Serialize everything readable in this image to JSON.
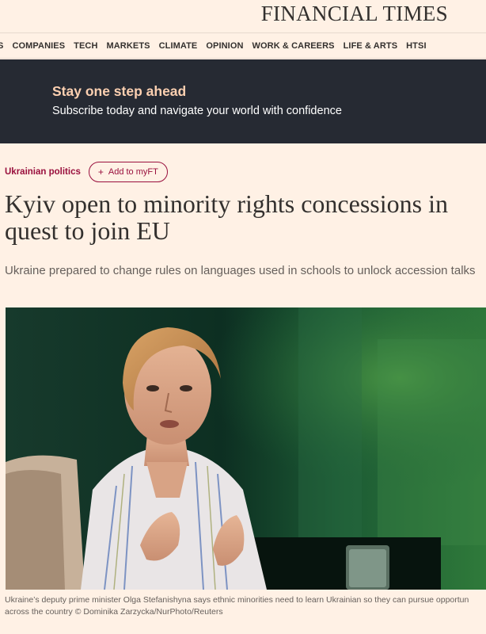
{
  "masthead": {
    "logo": "FINANCIAL TIMES"
  },
  "nav": {
    "items": [
      "S",
      "COMPANIES",
      "TECH",
      "MARKETS",
      "CLIMATE",
      "OPINION",
      "WORK & CAREERS",
      "LIFE & ARTS",
      "HTSI"
    ]
  },
  "promo": {
    "title": "Stay one step ahead",
    "subtitle": "Subscribe today and navigate your world with confidence"
  },
  "article": {
    "topic": "Ukrainian politics",
    "myft_button": "Add to myFT",
    "headline_line1": "Kyiv open to minority rights concessions in",
    "headline_line2": "quest to join EU",
    "standfirst": "Ukraine prepared to change rules on languages used in schools to unlock accession talks",
    "caption_line1": "Ukraine’s deputy prime minister Olga Stefanishyna says ethnic minorities need to learn Ukrainian so they can pursue opportun",
    "caption_line2": "across the country © Dominika Zarzycka/NurPhoto/Reuters"
  },
  "colors": {
    "background": "#fff1e5",
    "promo_background": "#262a33",
    "promo_title": "#fcd0b1",
    "claret": "#990f3d"
  }
}
